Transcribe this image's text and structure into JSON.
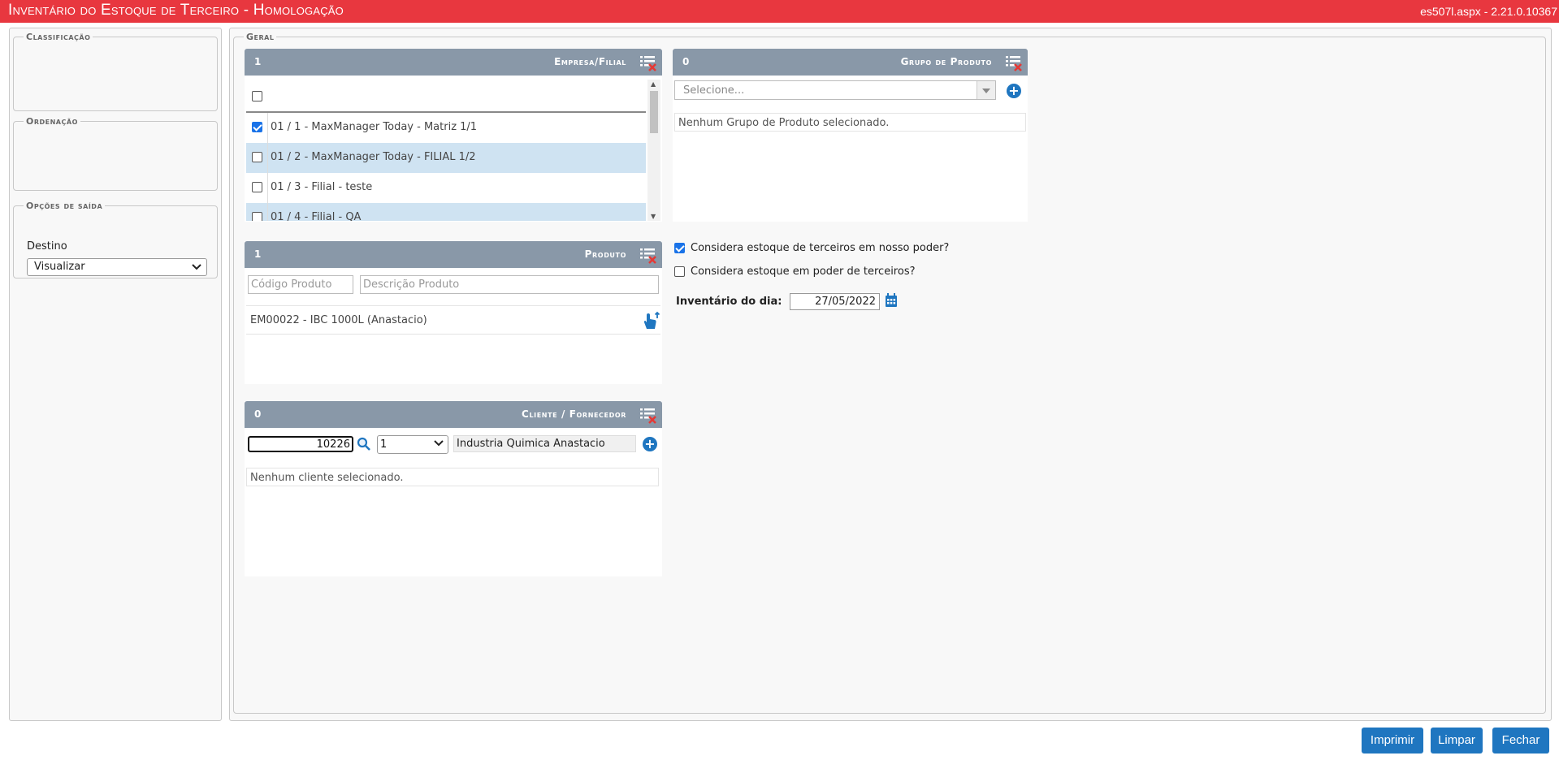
{
  "window": {
    "title": "Inventário do Estoque de Terceiro  - Homologação",
    "version": "es507l.aspx - 2.21.0.10367"
  },
  "sidebar": {
    "classificacao_legend": "Classificação",
    "ordenacao_legend": "Ordenação",
    "opcoes_legend": "Opções de saída",
    "destino_label": "Destino",
    "destino_value": "Visualizar"
  },
  "geral": {
    "legend": "Geral",
    "empresa": {
      "count": "1",
      "title": "Empresa/Filial",
      "rows": [
        {
          "label": "01 / 1 - MaxManager Today - Matriz 1/1",
          "checked": true
        },
        {
          "label": "01 / 2 - MaxManager Today - FILIAL 1/2",
          "checked": false
        },
        {
          "label": "01 / 3 - Filial - teste",
          "checked": false
        },
        {
          "label": "01 / 4 - Filial - QA",
          "checked": false
        }
      ]
    },
    "grupo": {
      "count": "0",
      "title": "Grupo de Produto",
      "select_placeholder": "Selecione...",
      "empty_text": "Nenhum Grupo de Produto selecionado."
    },
    "produto": {
      "count": "1",
      "title": "Produto",
      "codigo_placeholder": "Código Produto",
      "descricao_placeholder": "Descrição Produto",
      "item": "EM00022 - IBC 1000L (Anastacio)"
    },
    "cliente": {
      "count": "0",
      "title": "Cliente / Fornecedor",
      "code_value": "10226",
      "branch_value": "1",
      "name_value": "Industria Quimica Anastacio",
      "empty_text": "Nenhum cliente selecionado."
    },
    "options": {
      "nosso_poder": "Considera estoque de terceiros em nosso poder?",
      "nosso_poder_checked": true,
      "poder_terceiros": "Considera estoque em poder de terceiros?",
      "poder_terceiros_checked": false,
      "inventario_label": "Inventário do dia:",
      "inventario_date": "27/05/2022"
    }
  },
  "footer": {
    "imprimir": "Imprimir",
    "limpar": "Limpar",
    "fechar": "Fechar"
  },
  "colors": {
    "title_bar": "#e8373f",
    "panel_header": "#8998a8",
    "accent": "#1f76c0",
    "row_highlight": "#cfe3f2"
  }
}
